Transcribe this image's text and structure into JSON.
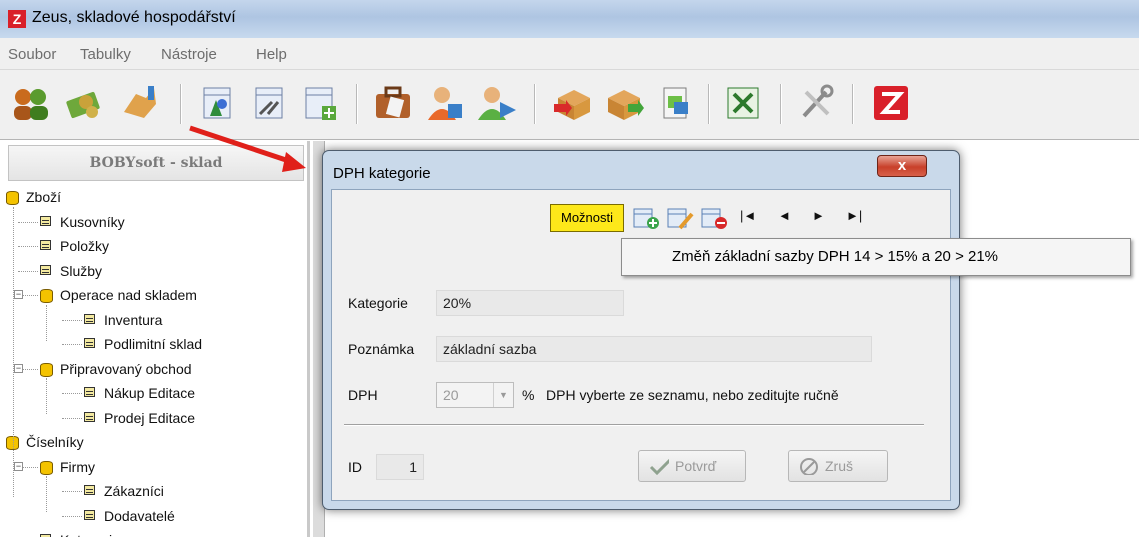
{
  "window": {
    "title": "Zeus, skladové hospodářství",
    "icon_letter": "Z"
  },
  "menubar": [
    "Soubor",
    "Tabulky",
    "Nástroje",
    "Help"
  ],
  "toolbar": {
    "icons": [
      "users-icon",
      "money-icon",
      "handshake-icon",
      "table-chart-icon",
      "table-tools-icon",
      "table-add-icon",
      "briefcase-icon",
      "contact-icon",
      "contact-send-icon",
      "box-in-icon",
      "box-out-icon",
      "document-icon",
      "excel-icon",
      "tools-icon",
      "zeus-logo-icon"
    ]
  },
  "left_panel": {
    "header": "BOBYsoft - sklad",
    "tree": [
      {
        "label": "Zboží",
        "type": "folder",
        "level": 0
      },
      {
        "label": "Kusovníky",
        "type": "table",
        "level": 1
      },
      {
        "label": "Položky",
        "type": "table",
        "level": 1
      },
      {
        "label": "Služby",
        "type": "table",
        "level": 1
      },
      {
        "label": "Operace nad skladem",
        "type": "folder",
        "level": 1,
        "expander": "−"
      },
      {
        "label": "Inventura",
        "type": "table",
        "level": 2
      },
      {
        "label": "Podlimitní sklad",
        "type": "table",
        "level": 2
      },
      {
        "label": "Připravovaný obchod",
        "type": "folder",
        "level": 1,
        "expander": "−"
      },
      {
        "label": "Nákup Editace",
        "type": "table",
        "level": 2
      },
      {
        "label": "Prodej Editace",
        "type": "table",
        "level": 2
      },
      {
        "label": "Číselníky",
        "type": "folder",
        "level": 0
      },
      {
        "label": "Firmy",
        "type": "folder",
        "level": 1,
        "expander": "−"
      },
      {
        "label": "Zákazníci",
        "type": "table",
        "level": 2
      },
      {
        "label": "Dodavatelé",
        "type": "table",
        "level": 2
      },
      {
        "label": "Kategorie",
        "type": "table",
        "level": 1
      }
    ]
  },
  "dialog": {
    "title": "DPH kategorie",
    "close_label": "x",
    "options_label": "Možnosti",
    "nav": [
      "|◄",
      "◄",
      "►",
      "►|"
    ],
    "fields": {
      "kategorie_label": "Kategorie",
      "kategorie_value": "20%",
      "poznamka_label": "Poznámka",
      "poznamka_value": "základní sazba",
      "dph_label": "DPH",
      "dph_value": "20",
      "dph_unit": "%",
      "dph_hint": "DPH vyberte ze seznamu, nebo zeditujte ručně",
      "id_label": "ID",
      "id_value": "1"
    },
    "buttons": {
      "confirm": "Potvrď",
      "cancel": "Zruš"
    }
  },
  "popup_menu": {
    "items": [
      "Změň základní sazby DPH  14 > 15% a 20 > 21%"
    ]
  },
  "colors": {
    "accent_arrow": "#e0201a",
    "options_button": "#fde81a",
    "close_button": "#c8402a"
  }
}
